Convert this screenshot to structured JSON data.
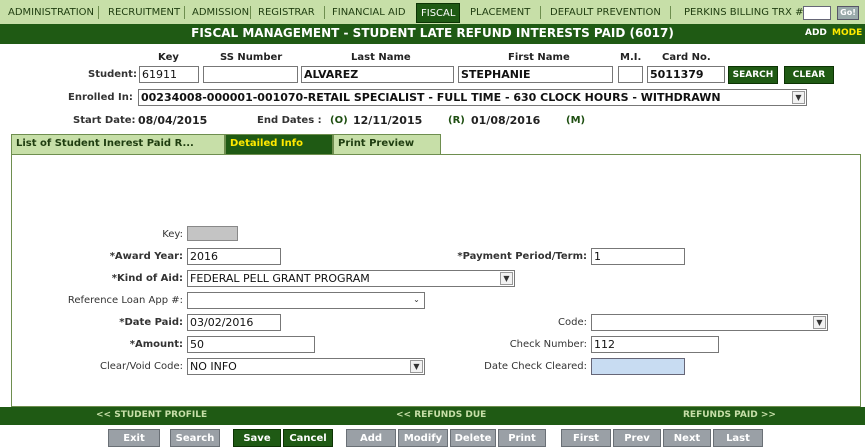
{
  "nav": {
    "items": [
      "ADMINISTRATION",
      "RECRUITMENT",
      "ADMISSION",
      "REGISTRAR",
      "FINANCIAL AID",
      "FISCAL",
      "PLACEMENT",
      "DEFAULT PREVENTION",
      "PERKINS BILLING"
    ],
    "active": "FISCAL",
    "trx_label": "TRX #:",
    "go_label": "Go!"
  },
  "title": {
    "text": "FISCAL MANAGEMENT - STUDENT LATE REFUND INTERESTS PAID (6017)",
    "add": "ADD",
    "mode": "MODE"
  },
  "student": {
    "headers": {
      "key": "Key",
      "ss": "SS Number",
      "last": "Last Name",
      "first": "First Name",
      "mi": "M.I.",
      "card": "Card No."
    },
    "label": "Student:",
    "key": "61911",
    "ss": "",
    "last": "ALVAREZ",
    "first": "STEPHANIE",
    "mi": "",
    "card": "5011379",
    "search_btn": "SEARCH",
    "clear_btn": "CLEAR",
    "enrolled_label": "Enrolled In:",
    "enrolled_value": "00234008-000001-001070-RETAIL SPECIALIST - FULL TIME - 630 CLOCK HOURS - WITHDRAWN",
    "start_label": "Start Date:",
    "start_value": "08/04/2015",
    "end_label": "End Dates :",
    "o_label": "(O)",
    "o_value": "12/11/2015",
    "r_label": "(R)",
    "r_value": "01/08/2016",
    "m_label": "(M)"
  },
  "tabs": [
    {
      "label": "List of Student Inerest Paid R...",
      "active": false
    },
    {
      "label": "Detailed Info",
      "active": true
    },
    {
      "label": "Print Preview",
      "active": false
    }
  ],
  "form": {
    "key_label": "Key:",
    "key_value": "",
    "award_year_label": "*Award Year:",
    "award_year": "2016",
    "payment_period_label": "*Payment Period/Term:",
    "payment_period": "1",
    "kind_of_aid_label": "*Kind of Aid:",
    "kind_of_aid": "FEDERAL PELL GRANT PROGRAM",
    "ref_loan_label": "Reference Loan App #:",
    "ref_loan": "",
    "date_paid_label": "*Date Paid:",
    "date_paid": "03/02/2016",
    "code_label": "Code:",
    "code": "",
    "amount_label": "*Amount:",
    "amount": "50",
    "check_number_label": "Check Number:",
    "check_number": "112",
    "clear_void_label": "Clear/Void Code:",
    "clear_void": "NO INFO",
    "date_check_cleared_label": "Date Check Cleared:",
    "date_check_cleared": ""
  },
  "footer_nav": {
    "profile": "<< STUDENT PROFILE",
    "refunds_due": "<< REFUNDS DUE",
    "refunds_paid": "REFUNDS PAID >>"
  },
  "buttons": {
    "exit": "Exit",
    "search": "Search",
    "save": "Save",
    "cancel": "Cancel",
    "add": "Add",
    "modify": "Modify",
    "delete": "Delete",
    "print": "Print",
    "first": "First",
    "prev": "Prev",
    "next": "Next",
    "last": "Last"
  },
  "colors": {
    "primary": "#1f5a14",
    "nav_bg": "#c7dfa8",
    "highlight": "#ffe900",
    "disabled": "#9aa0a6"
  }
}
